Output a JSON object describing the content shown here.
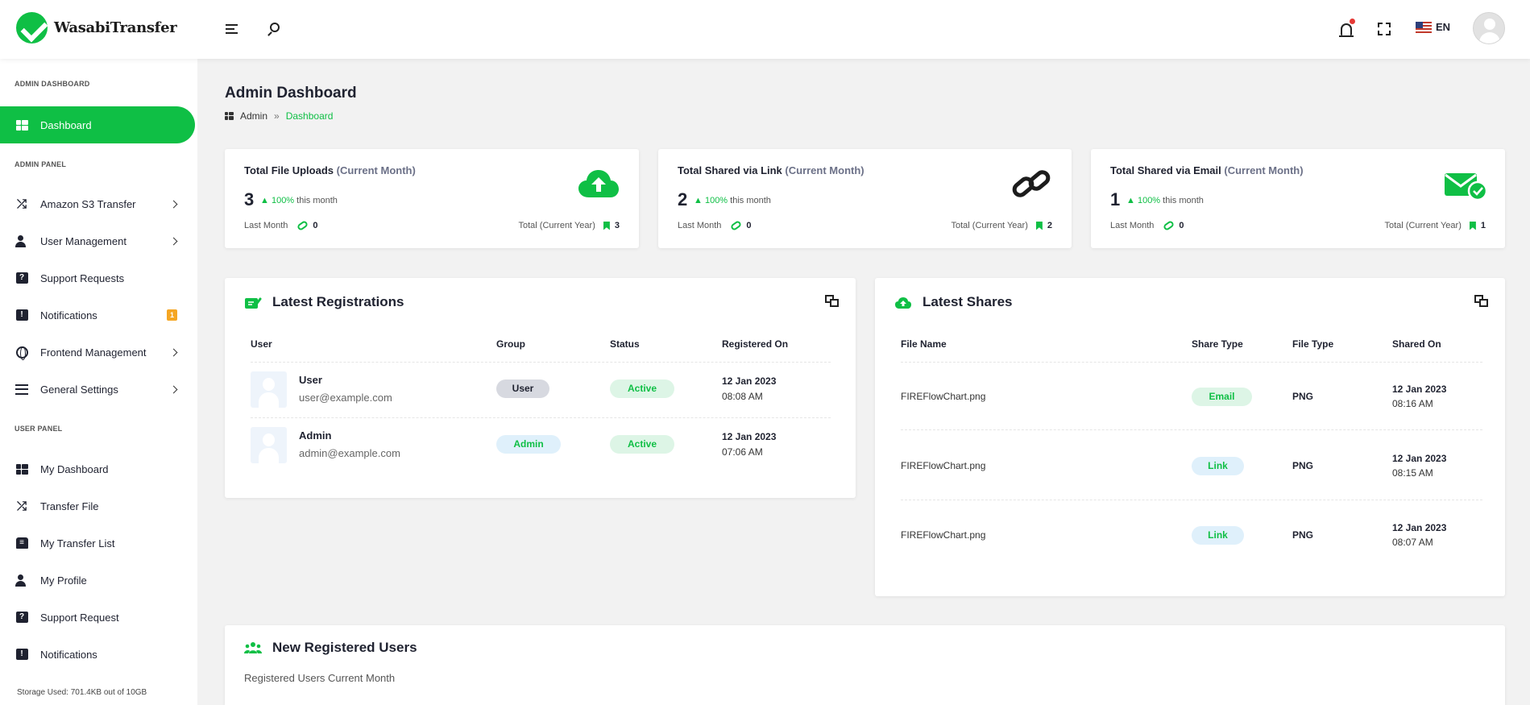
{
  "header": {
    "brand": "WasabiTransfer",
    "language": "EN"
  },
  "sidebar": {
    "sections": {
      "admin_dashboard": "ADMIN DASHBOARD",
      "admin_panel": "ADMIN PANEL",
      "user_panel": "USER PANEL"
    },
    "items": [
      {
        "label": "Dashboard",
        "icon": "dashboard-grid-icon",
        "active": true
      },
      {
        "label": "Amazon S3 Transfer",
        "icon": "shuffle-icon",
        "chevron": true
      },
      {
        "label": "User Management",
        "icon": "user-cog-icon",
        "chevron": true
      },
      {
        "label": "Support Requests",
        "icon": "question-icon"
      },
      {
        "label": "Notifications",
        "icon": "alert-icon",
        "badge": "1"
      },
      {
        "label": "Frontend Management",
        "icon": "globe-icon",
        "chevron": true
      },
      {
        "label": "General Settings",
        "icon": "sliders-icon",
        "chevron": true
      },
      {
        "label": "My Dashboard",
        "icon": "dashboard-grid-icon"
      },
      {
        "label": "Transfer File",
        "icon": "shuffle-icon"
      },
      {
        "label": "My Transfer List",
        "icon": "transfer-list-icon"
      },
      {
        "label": "My Profile",
        "icon": "user-cog-icon"
      },
      {
        "label": "Support Request",
        "icon": "question-icon"
      },
      {
        "label": "Notifications",
        "icon": "alert-icon"
      }
    ],
    "storage": "Storage Used: 701.4KB out of 10GB"
  },
  "page": {
    "title": "Admin Dashboard",
    "breadcrumb": [
      "Admin",
      "»",
      "Dashboard"
    ]
  },
  "stats": [
    {
      "title": "Total File Uploads ",
      "title_suffix": "(Current Month)",
      "value": "3",
      "change": "100%",
      "change_text": " this month",
      "last_month_label": "Last Month",
      "last_month_value": "0",
      "year_label": "Total (Current Year)",
      "year_value": "3",
      "icon": "cloud-upload-icon"
    },
    {
      "title": "Total Shared via Link ",
      "title_suffix": "(Current Month)",
      "value": "2",
      "change": "100%",
      "change_text": " this month",
      "last_month_label": "Last Month",
      "last_month_value": "0",
      "year_label": "Total (Current Year)",
      "year_value": "2",
      "icon": "link-icon"
    },
    {
      "title": "Total Shared via Email ",
      "title_suffix": "(Current Month)",
      "value": "1",
      "change": "100%",
      "change_text": " this month",
      "last_month_label": "Last Month",
      "last_month_value": "0",
      "year_label": "Total (Current Year)",
      "year_value": "1",
      "icon": "mail-check-icon"
    }
  ],
  "registrations": {
    "title": "Latest Registrations",
    "columns": [
      "User",
      "Group",
      "Status",
      "Registered On"
    ],
    "rows": [
      {
        "name": "User",
        "email": "user@example.com",
        "group": "User",
        "status": "Active",
        "date": "12 Jan 2023",
        "time": "08:08 AM"
      },
      {
        "name": "Admin",
        "email": "admin@example.com",
        "group": "Admin",
        "status": "Active",
        "date": "12 Jan 2023",
        "time": "07:06 AM"
      }
    ]
  },
  "shares": {
    "title": "Latest Shares",
    "columns": [
      "File Name",
      "Share Type",
      "File Type",
      "Shared On"
    ],
    "rows": [
      {
        "file": "FIREFlowChart.png",
        "type": "Email",
        "filetype": "PNG",
        "date": "12 Jan 2023",
        "time": "08:16 AM"
      },
      {
        "file": "FIREFlowChart.png",
        "type": "Link",
        "filetype": "PNG",
        "date": "12 Jan 2023",
        "time": "08:15 AM"
      },
      {
        "file": "FIREFlowChart.png",
        "type": "Link",
        "filetype": "PNG",
        "date": "12 Jan 2023",
        "time": "08:07 AM"
      }
    ]
  },
  "new_users": {
    "title": "New Registered Users",
    "subtitle": "Registered Users Current Month"
  },
  "colors": {
    "accent": "#0fbf45",
    "badge": "#f5a623"
  }
}
